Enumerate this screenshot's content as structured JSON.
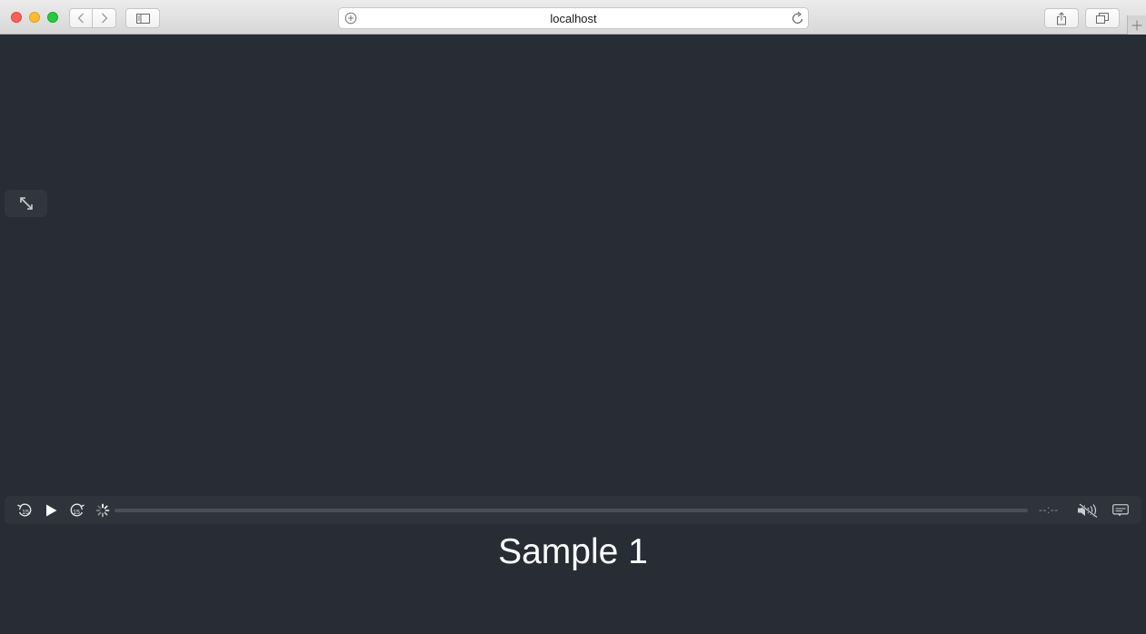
{
  "browser": {
    "address": "localhost",
    "icons": {
      "back": "chevron-left-icon",
      "forward": "chevron-right-icon",
      "sidebar": "sidebar-icon",
      "share": "share-icon",
      "tabs": "tabs-overview-icon",
      "reload": "reload-icon",
      "new_tab": "plus-icon"
    }
  },
  "player": {
    "title": "Sample 1",
    "time_remaining": "--:--",
    "skip_seconds": "15",
    "progress": 0,
    "muted": true,
    "icons": {
      "fullscreen": "expand-arrows-icon",
      "skip_back": "skip-back-15-icon",
      "play": "play-icon",
      "skip_forward": "skip-forward-15-icon",
      "loading": "loading-spinner-icon",
      "mute": "muted-speaker-icon",
      "captions": "captions-icon"
    }
  },
  "colors": {
    "page_background": "#282c35",
    "control_bar": "#2f333b",
    "title_text": "#ffffff"
  }
}
